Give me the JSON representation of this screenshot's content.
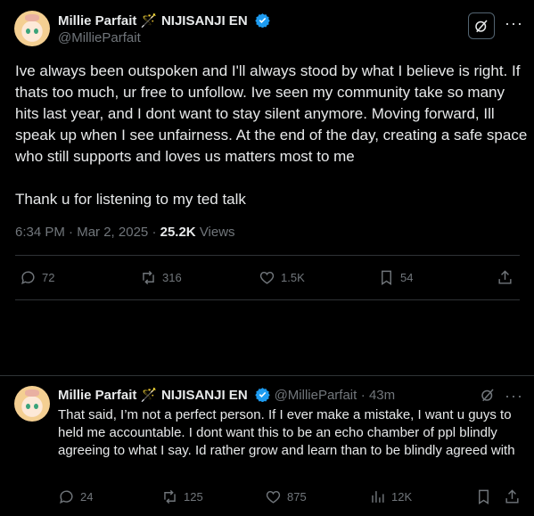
{
  "tweet": {
    "display_name": "Millie Parfait",
    "emoji": "🪄",
    "affiliation": "NIJISANJI EN",
    "handle": "@MillieParfait",
    "body_paragraph_1": "Ive always been outspoken and I'll always stood by what I believe is right. If thats too much, ur free to unfollow. Ive seen my community take so many hits last year, and I dont want to stay silent anymore. Moving forward, Ill speak up when I see unfairness. At the end of the day, creating a safe space who still supports and loves us matters most to me",
    "body_paragraph_2": "Thank u for listening to my ted talk",
    "time": "6:34 PM",
    "date": "Mar 2, 2025",
    "views_count": "25.2K",
    "views_label": "Views",
    "replies": "72",
    "reposts": "316",
    "likes": "1.5K",
    "bookmarks": "54"
  },
  "reply": {
    "display_name": "Millie Parfait",
    "emoji": "🪄",
    "affiliation": "NIJISANJI EN",
    "handle": "@MillieParfait",
    "age": "43m",
    "text": "That said, I’m not a perfect person. If I ever make a mistake, I want u guys to held me accountable. I dont want this to be an echo chamber of ppl blindly agreeing to what I say. Id rather grow and learn than to be blindly agreed with",
    "replies": "24",
    "reposts": "125",
    "likes": "875",
    "views": "12K"
  },
  "colors": {
    "background": "#000000",
    "text": "#e7e9ea",
    "muted": "#71767b",
    "verified": "#1d9bf0",
    "divider": "#2f3336"
  },
  "icons": [
    "verified-badge-icon",
    "grok-icon",
    "more-icon",
    "reply-icon",
    "repost-icon",
    "like-icon",
    "bookmark-icon",
    "share-icon",
    "views-icon"
  ]
}
